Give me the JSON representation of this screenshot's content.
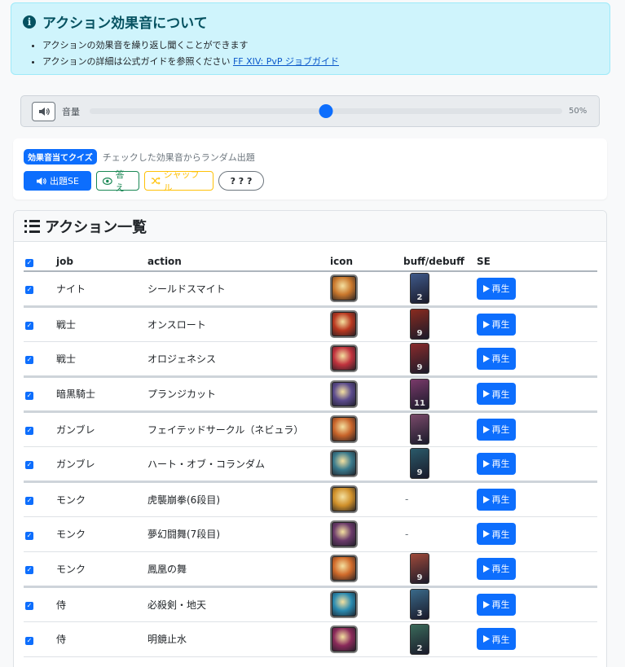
{
  "info": {
    "title": "アクション効果音について",
    "items": [
      "アクションの効果音を繰り返し聞くことができます",
      "アクションの詳細は公式ガイドを参照ください"
    ],
    "link_text": "FF XIV: PvP ジョブガイド"
  },
  "volume": {
    "label": "音量",
    "value": 50,
    "percent_text": "50%"
  },
  "quiz": {
    "badge": "効果音当てクイズ",
    "description": "チェックした効果音からランダム出題",
    "play_label": "出題SE",
    "answer_label": "答え",
    "shuffle_label": "シャッフル",
    "mystery_label": "? ? ?"
  },
  "list": {
    "title": "アクション一覧",
    "columns": [
      "job",
      "action",
      "icon",
      "buff/debuff",
      "SE"
    ],
    "play_label": "再生",
    "rows": [
      {
        "job": "ナイト",
        "action": "シールドスマイト",
        "buff": "2",
        "icon_color": "#c9772c",
        "buff_color": "#3f5a8a"
      },
      {
        "job": "戦士",
        "action": "オンスロート",
        "buff": "9",
        "icon_color": "#b8371f",
        "buff_color": "#8a2b1f"
      },
      {
        "job": "戦士",
        "action": "オロジェネシス",
        "buff": "9",
        "icon_color": "#c0323d",
        "buff_color": "#8a2b2b"
      },
      {
        "job": "暗黒騎士",
        "action": "プランジカット",
        "buff": "11",
        "icon_color": "#5a4a8c",
        "buff_color": "#7a3a6a"
      },
      {
        "job": "ガンブレ",
        "action": "フェイテッドサークル（ネビュラ）",
        "buff": "1",
        "icon_color": "#c8642a",
        "buff_color": "#7a4a6a"
      },
      {
        "job": "ガンブレ",
        "action": "ハート・オブ・コランダム",
        "buff": "9",
        "icon_color": "#3a7a8c",
        "buff_color": "#2a5a6a"
      },
      {
        "job": "モンク",
        "action": "虎襲崩拳(6段目)",
        "buff": "-",
        "icon_color": "#d0902a",
        "buff_color": ""
      },
      {
        "job": "モンク",
        "action": "夢幻闘舞(7段目)",
        "buff": "-",
        "icon_color": "#6a3a6a",
        "buff_color": ""
      },
      {
        "job": "モンク",
        "action": "鳳凰の舞",
        "buff": "9",
        "icon_color": "#d06a2a",
        "buff_color": "#a04a3a"
      },
      {
        "job": "侍",
        "action": "必殺剣・地天",
        "buff": "3",
        "icon_color": "#2a8ab0",
        "buff_color": "#3a6a8a"
      },
      {
        "job": "侍",
        "action": "明鏡止水",
        "buff": "2",
        "icon_color": "#8a2a5a",
        "buff_color": "#3a6a5a"
      }
    ]
  }
}
